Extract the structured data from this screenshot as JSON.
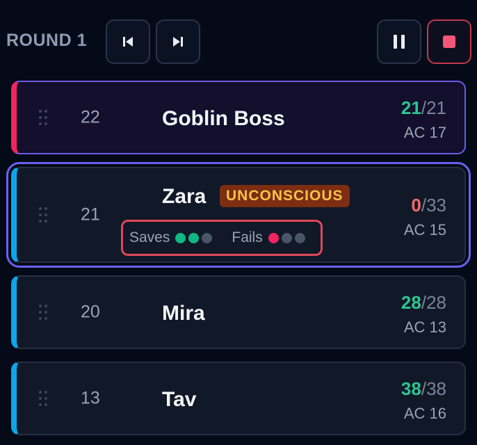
{
  "toolbar": {
    "round_label": "ROUND 1",
    "buttons": [
      {
        "name": "previous-turn",
        "icon": "skip-back-icon"
      },
      {
        "name": "next-turn",
        "icon": "skip-forward-icon"
      },
      {
        "name": "pause",
        "icon": "pause-icon"
      },
      {
        "name": "stop",
        "icon": "stop-icon"
      }
    ]
  },
  "colors": {
    "active_turn": "#f0245e",
    "party": "#0ea5e9",
    "hp_ok": "#2dc58f",
    "hp_zero": "#f16a6a",
    "selected": "#6a62f0",
    "save_success": "#10b981",
    "save_fail": "#f0245e"
  },
  "combatants": [
    {
      "initiative": "22",
      "name": "Goblin Boss",
      "hp_current": "21",
      "hp_sep": "/",
      "hp_max": "21",
      "ac": "AC 17"
    },
    {
      "initiative": "21",
      "name": "Zara",
      "status": "UNCONSCIOUS",
      "hp_current": "0",
      "hp_sep": "/",
      "hp_max": "33",
      "ac": "AC 15",
      "death_saves": {
        "saves_label": "Saves",
        "fails_label": "Fails",
        "successes": 2,
        "failures": 1,
        "total": 3
      }
    },
    {
      "initiative": "20",
      "name": "Mira",
      "hp_current": "28",
      "hp_sep": "/",
      "hp_max": "28",
      "ac": "AC 13"
    },
    {
      "initiative": "13",
      "name": "Tav",
      "hp_current": "38",
      "hp_sep": "/",
      "hp_max": "38",
      "ac": "AC 16"
    }
  ]
}
